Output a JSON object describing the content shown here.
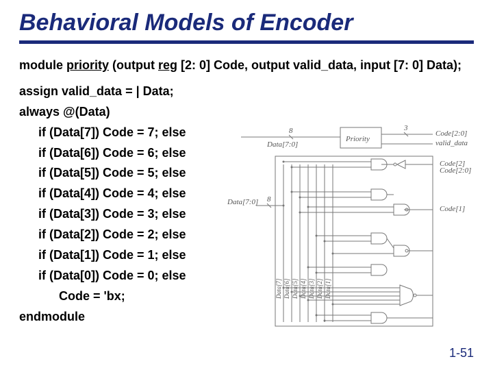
{
  "title": "Behavioral Models of Encoder",
  "decl_prefix": "module ",
  "decl_name": "priority",
  "decl_mid": " (output ",
  "decl_reg": "reg",
  "decl_rest": " [2: 0] Code, output valid_data, input [7: 0] Data);",
  "assign": "assign valid_data = | Data;",
  "always": "always @(Data)",
  "ifs": [
    "if (Data[7])  Code = 7; else",
    "if (Data[6])  Code = 6; else",
    "if (Data[5])  Code = 5; else",
    "if (Data[4])  Code = 4; else",
    "if (Data[3])  Code = 3; else",
    "if (Data[2])  Code = 2; else",
    "if (Data[1])  Code = 1; else",
    "if (Data[0])  Code = 0; else"
  ],
  "codebx": "Code = 'bx;",
  "endmodule": "endmodule",
  "pagenum": "1-51",
  "d": {
    "top_data": "Data[7:0]",
    "top_prio": "Priority",
    "top_code": "Code[2:0]",
    "top_valid": "valid_data",
    "top_8": "8",
    "top_3": "3",
    "left_data": "Data[7:0]",
    "left_8": "8",
    "code2": "Code[2]",
    "code1": "Code[1]",
    "code20": "Code[2:0]",
    "d7": "Data[7]",
    "d6": "Data[6]",
    "d5": "Data[5]",
    "d4": "Data[4]",
    "d3": "Data[3]",
    "d2": "Data[2]",
    "d1": "Data[1]"
  }
}
